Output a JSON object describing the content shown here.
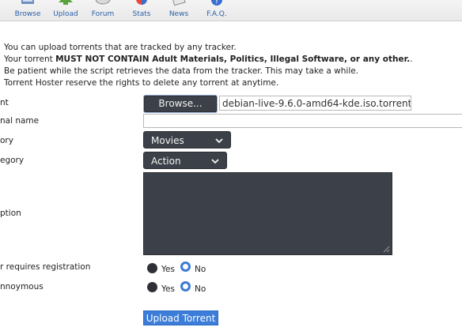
{
  "nav": {
    "items": [
      {
        "label": "Browse",
        "icon": "browse-icon"
      },
      {
        "label": "Upload",
        "icon": "upload-icon"
      },
      {
        "label": "Forum",
        "icon": "forum-icon"
      },
      {
        "label": "Stats",
        "icon": "stats-icon"
      },
      {
        "label": "News",
        "icon": "news-icon"
      },
      {
        "label": "F.A.Q.",
        "icon": "faq-icon"
      }
    ]
  },
  "notes": {
    "line1": "You can upload torrents that are tracked by any tracker.",
    "line2_prefix": "Your torrent ",
    "line2_bold": "MUST NOT CONTAIN Adult Materials, Politics, Illegal Software, or any other.",
    "line2_suffix": ".",
    "line3": "Be patient while the script retrieves the data from the tracker. This may take a while.",
    "line4": "Torrent Hoster reserve the rights to delete any torrent at anytime."
  },
  "form": {
    "torrent_label": "nt",
    "browse_button": "Browse...",
    "file_name": "debian-live-9.6.0-amd64-kde.iso.torrent",
    "name_label": "nal name",
    "category_label": "ory",
    "category_value": "Movies",
    "subcategory_label": "egory",
    "subcategory_value": "Action",
    "description_label": "ption",
    "registration_label": "r requires registration",
    "anonymous_label": "nnoymous",
    "yes_label": "Yes",
    "no_label": "No",
    "registration_selected": "No",
    "anonymous_selected": "No",
    "submit_label": "Upload Torrent"
  },
  "colors": {
    "accent": "#3b7dd8",
    "control_dark": "#3c4048",
    "link": "#2a5fa8"
  }
}
